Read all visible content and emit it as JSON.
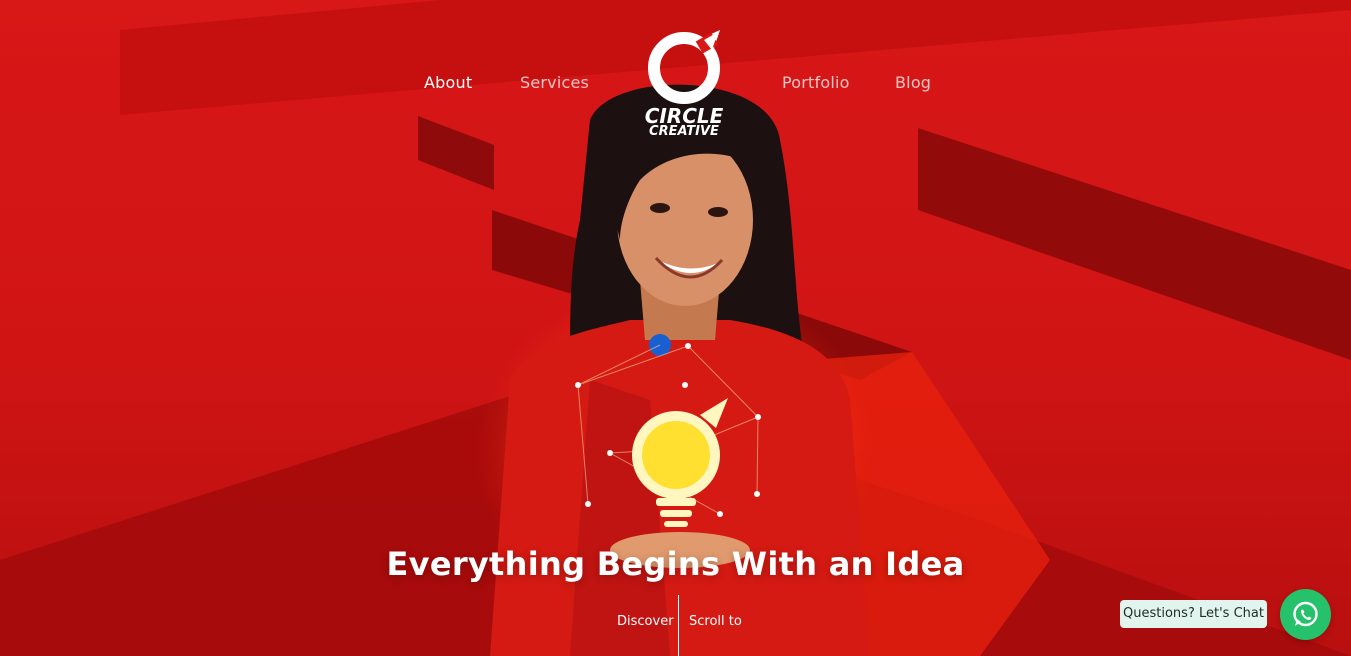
{
  "nav": {
    "items": [
      {
        "label": "About",
        "active": true
      },
      {
        "label": "Services",
        "active": false
      },
      {
        "label": "Portfolio",
        "active": false
      },
      {
        "label": "Blog",
        "active": false
      }
    ]
  },
  "logo": {
    "line1": "CIRCLE",
    "line2": "CREATIVE"
  },
  "hero": {
    "headline": "Everything Begins With an Idea",
    "scroll_left": "Discover",
    "scroll_right": "Scroll to"
  },
  "chat": {
    "bubble_label": "Questions? Let's Chat",
    "icon": "whatsapp-icon"
  },
  "colors": {
    "background": "#d81717",
    "accent_orange": "#ff7a1a",
    "chat_green": "#25c26b",
    "chat_bubble": "#e2f4ee"
  }
}
